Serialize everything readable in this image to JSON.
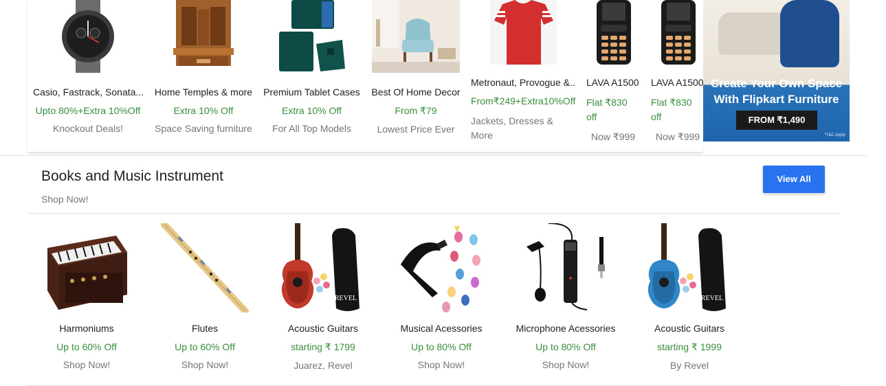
{
  "top_strip": {
    "items": [
      {
        "name": "Casio, Fastrack, Sonata...",
        "offer": "Upto 80%+Extra 10%Off",
        "tag": "Knockout Deals!",
        "icon": "wristwatch-image"
      },
      {
        "name": "Home Temples & more",
        "offer": "Extra 10% Off",
        "tag": "Space Saving furniture",
        "icon": "wooden-temple-image"
      },
      {
        "name": "Premium Tablet Cases",
        "offer": "Extra 10% Off",
        "tag": "For All Top Models",
        "icon": "tablet-case-image"
      },
      {
        "name": "Best Of Home Decor",
        "offer": "From ₹79",
        "tag": "Lowest Price Ever",
        "icon": "armchair-decor-image"
      },
      {
        "name": "Metronaut, Provogue &..",
        "offer": "From₹249+Extra10%Off",
        "tag": "Jackets, Dresses & More",
        "icon": "red-tshirt-image"
      },
      {
        "name": "LAVA A1500",
        "offer": "Flat ₹830 off",
        "tag": "Now ₹999",
        "icon": "feature-phone-image"
      },
      {
        "name": "LAVA A1500",
        "offer": "Flat ₹830 off",
        "tag": "Now ₹999",
        "icon": "feature-phone-image"
      }
    ],
    "banner": {
      "line1": "Create Your Own Space",
      "line2": "With Flipkart Furniture",
      "button": "FROM ₹1,490",
      "fine_print": "*T&C Apply"
    }
  },
  "section": {
    "title": "Books and Music Instrument",
    "subtitle": "Shop Now!",
    "view_all": "View All",
    "cards": [
      {
        "name": "Harmoniums",
        "offer": "Up to 60% Off",
        "tag": "Shop Now!",
        "icon": "harmonium-image"
      },
      {
        "name": "Flutes",
        "offer": "Up to 60% Off",
        "tag": "Shop Now!",
        "icon": "flute-image"
      },
      {
        "name": "Acoustic Guitars",
        "offer": "starting ₹ 1799",
        "tag": "Juarez, Revel",
        "icon": "red-guitar-image"
      },
      {
        "name": "Musical Acessories",
        "offer": "Up to 80% Off",
        "tag": "Shop Now!",
        "icon": "guitar-capo-picks-image"
      },
      {
        "name": "Microphone Acessories",
        "offer": "Up to 80% Off",
        "tag": "Shop Now!",
        "icon": "lapel-microphone-image"
      },
      {
        "name": "Acoustic Guitars",
        "offer": "starting ₹ 1999",
        "tag": "By Revel",
        "icon": "blue-guitar-image"
      }
    ],
    "guitar_bag_text": "REVEL"
  },
  "colors": {
    "accent": "#2874f0",
    "offer_green": "#388e3c",
    "muted": "#757575"
  }
}
